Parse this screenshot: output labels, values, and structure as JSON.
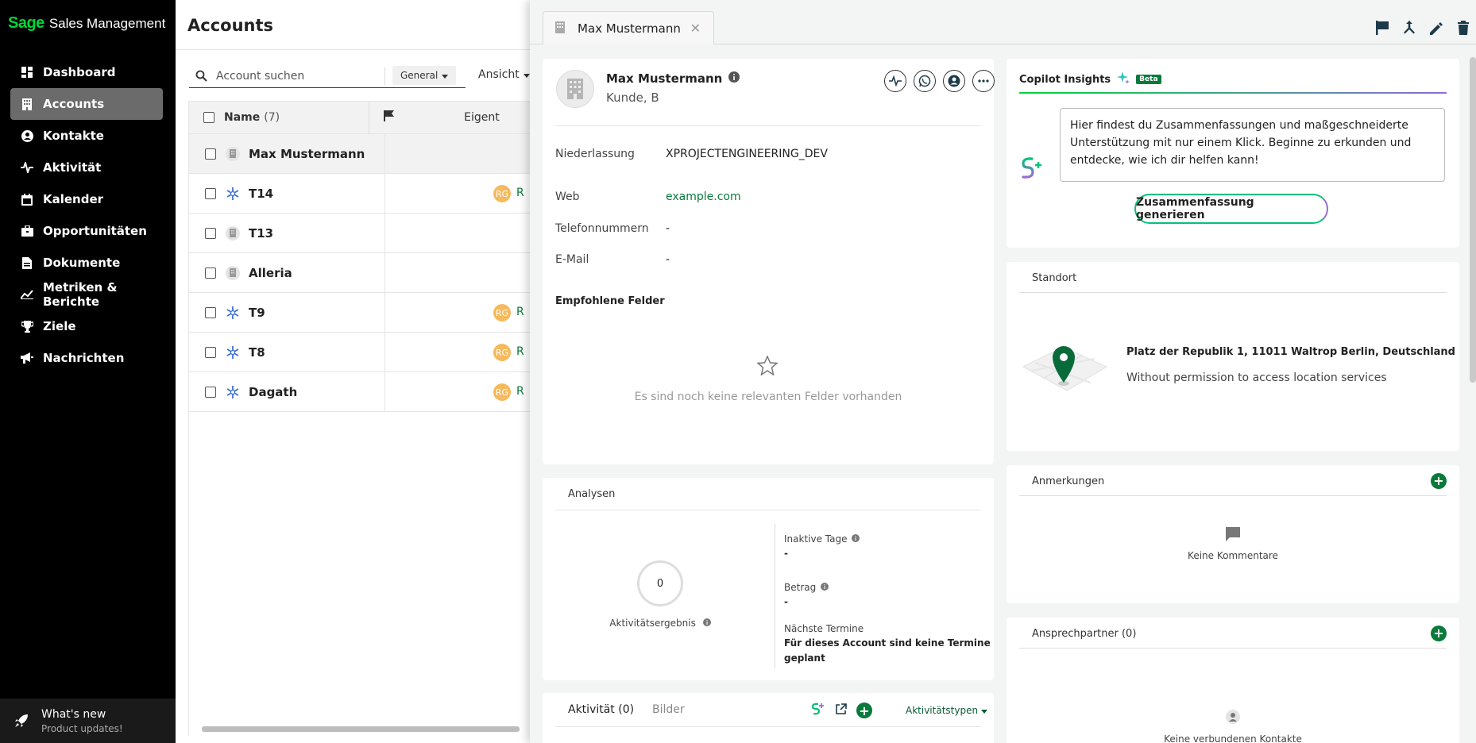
{
  "brand": {
    "logo": "Sage",
    "name": "Sales Management"
  },
  "sidebar": {
    "items": [
      {
        "label": "Dashboard",
        "icon": "dashboard-icon"
      },
      {
        "label": "Accounts",
        "icon": "building-icon",
        "active": true
      },
      {
        "label": "Kontakte",
        "icon": "person-icon"
      },
      {
        "label": "Aktivität",
        "icon": "pulse-icon"
      },
      {
        "label": "Kalender",
        "icon": "calendar-icon"
      },
      {
        "label": "Opportunitäten",
        "icon": "briefcase-icon"
      },
      {
        "label": "Dokumente",
        "icon": "document-icon"
      },
      {
        "label": "Metriken & Berichte",
        "icon": "chart-line-icon"
      },
      {
        "label": "Ziele",
        "icon": "trophy-icon"
      },
      {
        "label": "Nachrichten",
        "icon": "megaphone-icon"
      }
    ],
    "whats_new": {
      "title": "What's new",
      "subtitle": "Product updates!"
    }
  },
  "list": {
    "title": "Accounts",
    "search_placeholder": "Account suchen",
    "filter": "General",
    "view": "Ansicht",
    "columns": {
      "name": "Name",
      "count": "(7)",
      "owner": "Eigent"
    },
    "rows": [
      {
        "name": "Max Mustermann",
        "icon": "building",
        "owner": "",
        "selected": true
      },
      {
        "name": "T14",
        "icon": "snowflake",
        "owner": "RG",
        "owner_text": "R"
      },
      {
        "name": "T13",
        "icon": "building",
        "owner": ""
      },
      {
        "name": "Alleria",
        "icon": "building",
        "owner": ""
      },
      {
        "name": "T9",
        "icon": "snowflake",
        "owner": "RG",
        "owner_text": "R"
      },
      {
        "name": "T8",
        "icon": "snowflake",
        "owner": "RG",
        "owner_text": "R"
      },
      {
        "name": "Dagath",
        "icon": "snowflake",
        "owner": "RG",
        "owner_text": "R"
      }
    ]
  },
  "panel": {
    "tab_title": "Max Mustermann",
    "account": {
      "name": "Max Mustermann",
      "subtitle": "Kunde, B"
    },
    "fields": {
      "niederlassung_label": "Niederlassung",
      "niederlassung_value": "XPROJECTENGINEERING_DEV",
      "web_label": "Web",
      "web_value": "example.com",
      "tel_label": "Telefonnummern",
      "tel_value": "-",
      "email_label": "E-Mail",
      "email_value": "-"
    },
    "recommended": {
      "title": "Empfohlene Felder",
      "empty": "Es sind noch keine relevanten Felder vorhanden"
    },
    "analysen": {
      "title": "Analysen",
      "score": "0",
      "score_label": "Aktivitätsergebnis",
      "inactive_label": "Inaktive Tage",
      "inactive_value": "-",
      "betrag_label": "Betrag",
      "betrag_value": "-",
      "termine_label": "Nächste Termine",
      "termine_value_1": "Für dieses Account sind keine Termine",
      "termine_value_2": "geplant"
    },
    "activity": {
      "tab1": "Aktivität (0)",
      "tab2": "Bilder",
      "types": "Aktivitätstypen"
    },
    "copilot": {
      "title": "Copilot Insights",
      "badge": "Beta",
      "message": "Hier findest du Zusammenfassungen und maßgeschneiderte Unterstützung mit nur einem Klick. Beginne zu erkunden und entdecke, wie ich dir helfen kann!",
      "button": "Zusammenfassung generieren"
    },
    "standort": {
      "title": "Standort",
      "address": "Platz der Republik 1, 11011 Waltrop Berlin, Deutschland",
      "permission": "Without permission to access location services"
    },
    "anmerkungen": {
      "title": "Anmerkungen",
      "empty": "Keine Kommentare"
    },
    "ansprechpartner": {
      "title": "Ansprechpartner (0)",
      "empty": "Keine verbundenen Kontakte"
    }
  },
  "colors": {
    "brand_green": "#00d639",
    "link_green": "#0a7a3b",
    "sidebar_bg": "#000000",
    "owner_badge": "#f5b95e"
  }
}
